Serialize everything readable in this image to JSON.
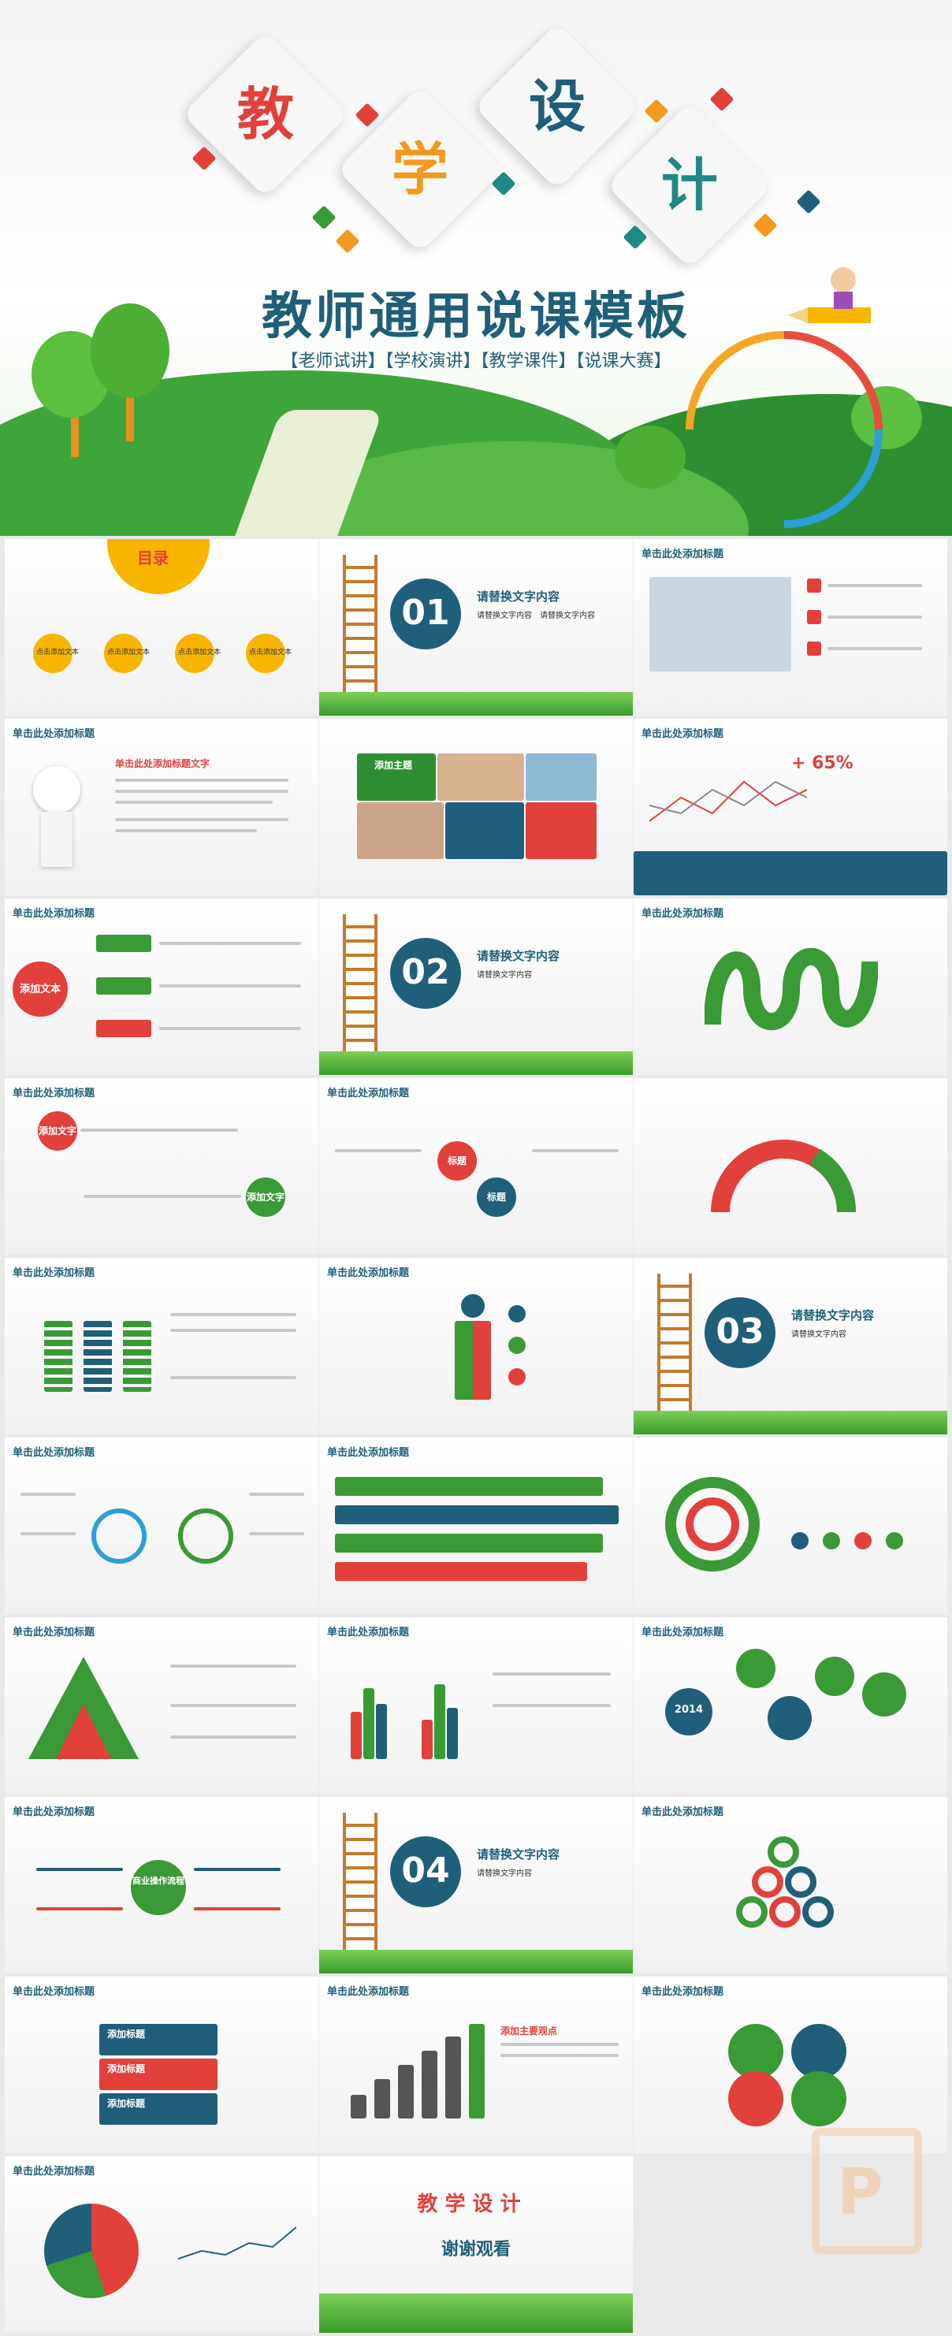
{
  "hero": {
    "chars": [
      "教",
      "学",
      "设",
      "计"
    ],
    "title": "教师通用说课模板",
    "tags": "【老师试讲】【学校演讲】【教学课件】【说课大赛】"
  },
  "slides": {
    "generic_header": "单击此处添加标题",
    "toc_label": "目录",
    "toc_items": [
      "点击添加文本",
      "点击添加文本",
      "点击添加文本",
      "点击添加文本"
    ],
    "section_numbers": [
      "01",
      "02",
      "03",
      "04"
    ],
    "section_title": "请替换文字内容",
    "section_sub": "请替换文字内容",
    "add_title_text": "单击此处添加标题文字",
    "add_theme": "添加主题",
    "add_text": "添加文本",
    "add_text_short": "添加文字",
    "percent": "+ 65%",
    "title_label": "标题",
    "add_title": "添加标题",
    "add_focus": "添加主要观点",
    "year": "2014",
    "ops_flow": "商业操作流程",
    "thanks": "谢谢观看"
  },
  "colors": {
    "teal": "#1f5f7a",
    "green": "#3a9a36",
    "red": "#e2403b",
    "orange": "#f39a1e",
    "grey": "#c8c8c8"
  }
}
